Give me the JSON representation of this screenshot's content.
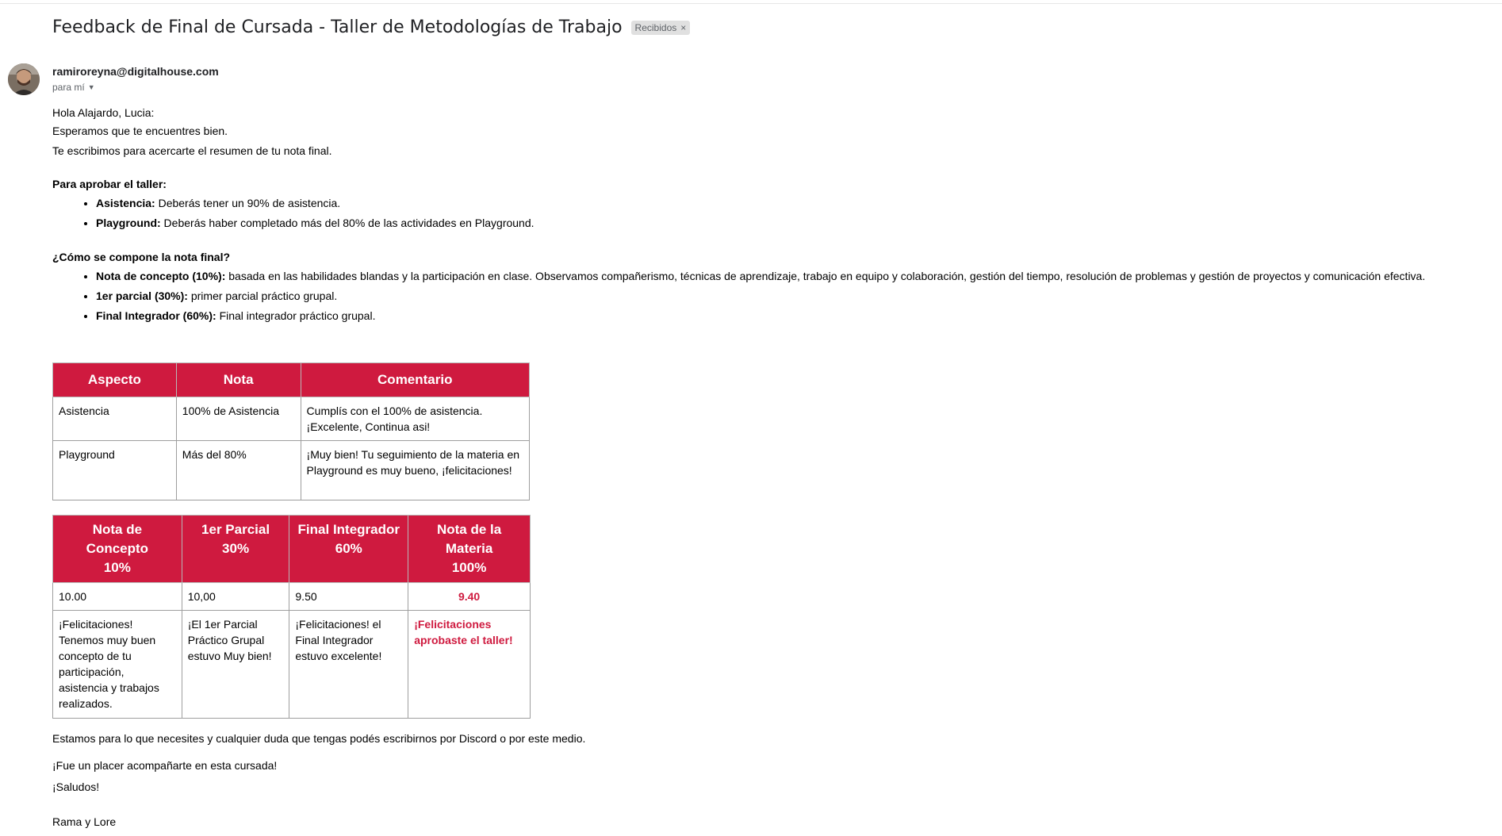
{
  "email": {
    "subject": "Feedback de Final de Cursada - Taller de Metodologías de Trabajo",
    "label": "Recibidos",
    "label_remove": "×",
    "sender": "ramiroreyna@digitalhouse.com",
    "recipient": "para mí"
  },
  "body": {
    "greeting": "Hola Alajardo, Lucia:",
    "line1": "Esperamos que te encuentres bien.",
    "line2": "Te escribimos para acercarte el resumen de tu nota final.",
    "approve": {
      "heading": "Para aprobar el taller:",
      "items": [
        {
          "term": "Asistencia:",
          "text": " Deberás tener un 90% de asistencia."
        },
        {
          "term": "Playground:",
          "text": " Deberás haber completado más del 80% de las actividades en Playground."
        }
      ]
    },
    "composition": {
      "heading": "¿Cómo se compone la nota final?",
      "items": [
        {
          "term": "Nota de concepto (10%):",
          "text": "  basada en las habilidades blandas y la participación en clase. Observamos compañerismo, técnicas de aprendizaje, trabajo en equipo y colaboración, gestión del tiempo, resolución de problemas y gestión de proyectos y comunicación efectiva."
        },
        {
          "term": "1er parcial (30%):",
          "text": " primer parcial práctico grupal."
        },
        {
          "term": "Final Integrador (60%):",
          "text": " Final integrador práctico grupal."
        }
      ]
    }
  },
  "table1": {
    "headers": [
      "Aspecto",
      "Nota",
      "Comentario"
    ],
    "rows": [
      {
        "aspect": "Asistencia",
        "grade": "100% de Asistencia",
        "comment": "Cumplís con el 100% de asistencia. ¡Excelente, Continua asi!"
      },
      {
        "aspect": "Playground",
        "grade": "Más del 80%",
        "comment": "¡Muy bien! Tu seguimiento de la materia en Playground es muy bueno, ¡felicitaciones!"
      }
    ]
  },
  "table2": {
    "headers": [
      {
        "line1": "Nota de",
        "line2": "Concepto",
        "line3": "10%"
      },
      {
        "line1": "1er Parcial",
        "line2": "30%"
      },
      {
        "line1": "Final Integrador",
        "line2": "60%"
      },
      {
        "line1": "Nota de la",
        "line2": "Materia",
        "line3": "100%"
      }
    ],
    "grades": [
      "10.00",
      "10,00",
      "9.50",
      "9.40"
    ],
    "comments": [
      "¡Felicitaciones! Tenemos muy buen concepto de tu participación, asistencia y trabajos realizados.",
      "¡El 1er Parcial Práctico Grupal estuvo Muy bien!",
      "¡Felicitaciones! el Final Integrador estuvo excelente!",
      "¡Felicitaciones aprobaste el taller!"
    ]
  },
  "closing": {
    "line1": "Estamos para lo que necesites y cualquier duda que tengas podés escribirnos por Discord o por este medio.",
    "line2": "¡Fue un placer acompañarte en esta cursada!",
    "line3": "¡Saludos!",
    "signature": "Rama y Lore"
  },
  "colors": {
    "accent": "#cf1a3f",
    "label_bg": "#e0e0e0"
  },
  "icons": {
    "avatar": "sender-avatar",
    "caret": "chevron-down-icon",
    "remove": "close-icon"
  }
}
